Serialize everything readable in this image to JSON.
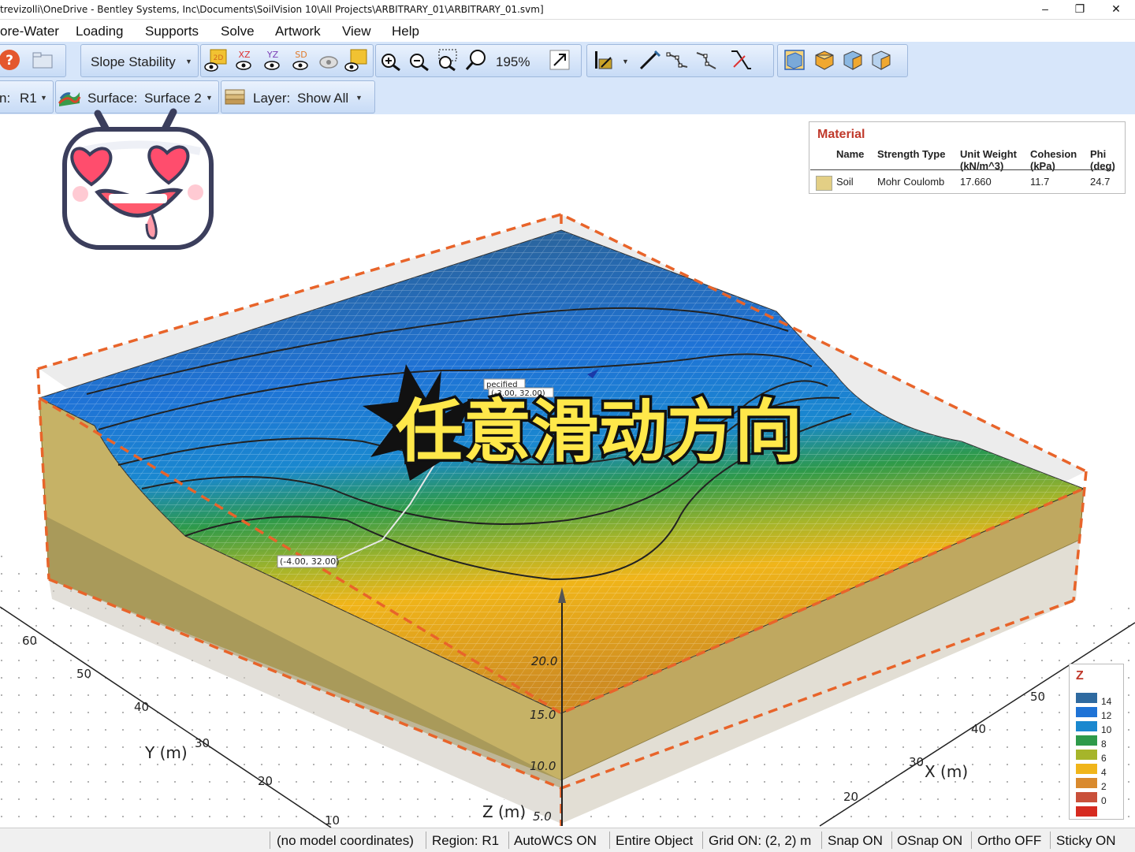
{
  "window": {
    "title": "trevizolli\\OneDrive - Bentley Systems, Inc\\Documents\\SoilVision 10\\All Projects\\ARBITRARY_01\\ARBITRARY_01.svm]",
    "controls": {
      "minimize": "–",
      "restore": "❐",
      "close": "✕"
    }
  },
  "menu": {
    "items": [
      "ore-Water",
      "Loading",
      "Supports",
      "Solve",
      "Artwork",
      "View",
      "Help"
    ]
  },
  "toolbar1": {
    "analysis_mode": "Slope Stability",
    "view_2d": "2D",
    "view_xz": "XZ",
    "view_yz": "YZ",
    "view_sd": "SD",
    "zoom_level": "195%"
  },
  "toolbar2": {
    "region_label": "n:",
    "region_value": "R1",
    "surface_label": "Surface:",
    "surface_value": "Surface 2",
    "layer_label": "Layer:",
    "layer_value": "Show All"
  },
  "material_legend": {
    "title": "Material",
    "columns": [
      "Name",
      "Strength Type",
      "Unit Weight\n(kN/m^3)",
      "Cohesion\n(kPa)",
      "Phi\n(deg)"
    ],
    "rows": [
      {
        "name": "Soil",
        "strength_type": "Mohr Coulomb",
        "unit_weight": "17.660",
        "cohesion": "11.7",
        "phi": "24.7",
        "color": "#e3cf85"
      }
    ]
  },
  "z_legend": {
    "title": "Z",
    "entries": [
      {
        "label": "14",
        "color": "#2f6aa0"
      },
      {
        "label": "12",
        "color": "#1f73d6"
      },
      {
        "label": "10",
        "color": "#1a88cf"
      },
      {
        "label": "8",
        "color": "#2e9a4a"
      },
      {
        "label": "6",
        "color": "#a6b52a"
      },
      {
        "label": "4",
        "color": "#f0b51a"
      },
      {
        "label": "2",
        "color": "#d98a2e"
      },
      {
        "label": "0",
        "color": "#c9503a"
      },
      {
        "label": "",
        "color": "#d62a1f"
      }
    ]
  },
  "viewport": {
    "overlay_caption": "任意滑动方向",
    "annotation_point": "(-4.00, 32.00)",
    "annotation_specified": "pecified",
    "annotation_point2": "(-3.00, 32.00)",
    "y_axis_label": "Y (m)",
    "x_axis_label": "X (m)",
    "z_axis_label": "Z (m)",
    "y_ticks": [
      "60",
      "50",
      "40",
      "30",
      "20",
      "10"
    ],
    "x_ticks": [
      "20",
      "30",
      "40",
      "50"
    ],
    "z_ticks": [
      "20.0",
      "15.0",
      "10.0",
      "5.0"
    ]
  },
  "status": {
    "coords": "(no model coordinates)",
    "region": "Region: R1",
    "autowcs": "AutoWCS ON",
    "object": "Entire Object",
    "grid": "Grid ON: (2, 2) m",
    "snap": "Snap ON",
    "osnap": "OSnap ON",
    "ortho": "Ortho OFF",
    "sticky": "Sticky ON"
  }
}
